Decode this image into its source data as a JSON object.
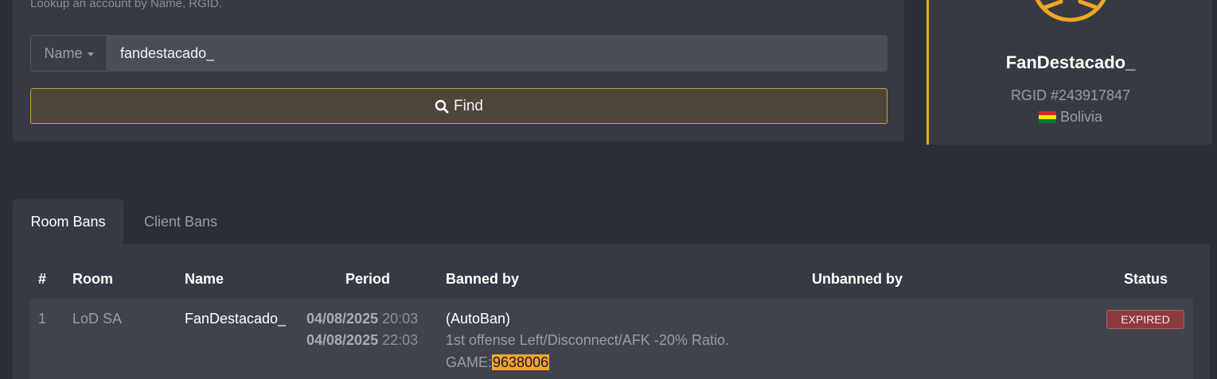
{
  "lookup": {
    "hint": "Lookup an account by Name, RGID.",
    "search_type": "Name",
    "search_value": "fandestacado_",
    "find_label": "Find"
  },
  "profile": {
    "name": "FanDestacado_",
    "rgid": "RGID #243917847",
    "country": "Bolivia",
    "flag_colors": [
      "#d52b1e",
      "#f9e300",
      "#007934"
    ]
  },
  "tabs": [
    "Room Bans",
    "Client Bans"
  ],
  "table": {
    "headers": {
      "index": "#",
      "room": "Room",
      "name": "Name",
      "period": "Period",
      "banned_by": "Banned by",
      "unbanned_by": "Unbanned by",
      "status": "Status"
    },
    "rows": [
      {
        "index": "1",
        "room": "LoD SA",
        "name": "FanDestacado_",
        "start_date": "04/08/2025",
        "start_time": "20:03",
        "end_date": "04/08/2025",
        "end_time": "22:03",
        "banned_by": "(AutoBan)",
        "reason": "1st offense Left/Disconnect/AFK -20% Ratio.",
        "game_prefix": "GAME:",
        "game_id": "9638006",
        "unbanned_by": "",
        "status": "EXPIRED"
      }
    ]
  },
  "colors": {
    "accent": "#f5a623",
    "find_border": "#c5a532",
    "expired_badge": "#8b3b3e",
    "highlight": "#f5a233"
  }
}
